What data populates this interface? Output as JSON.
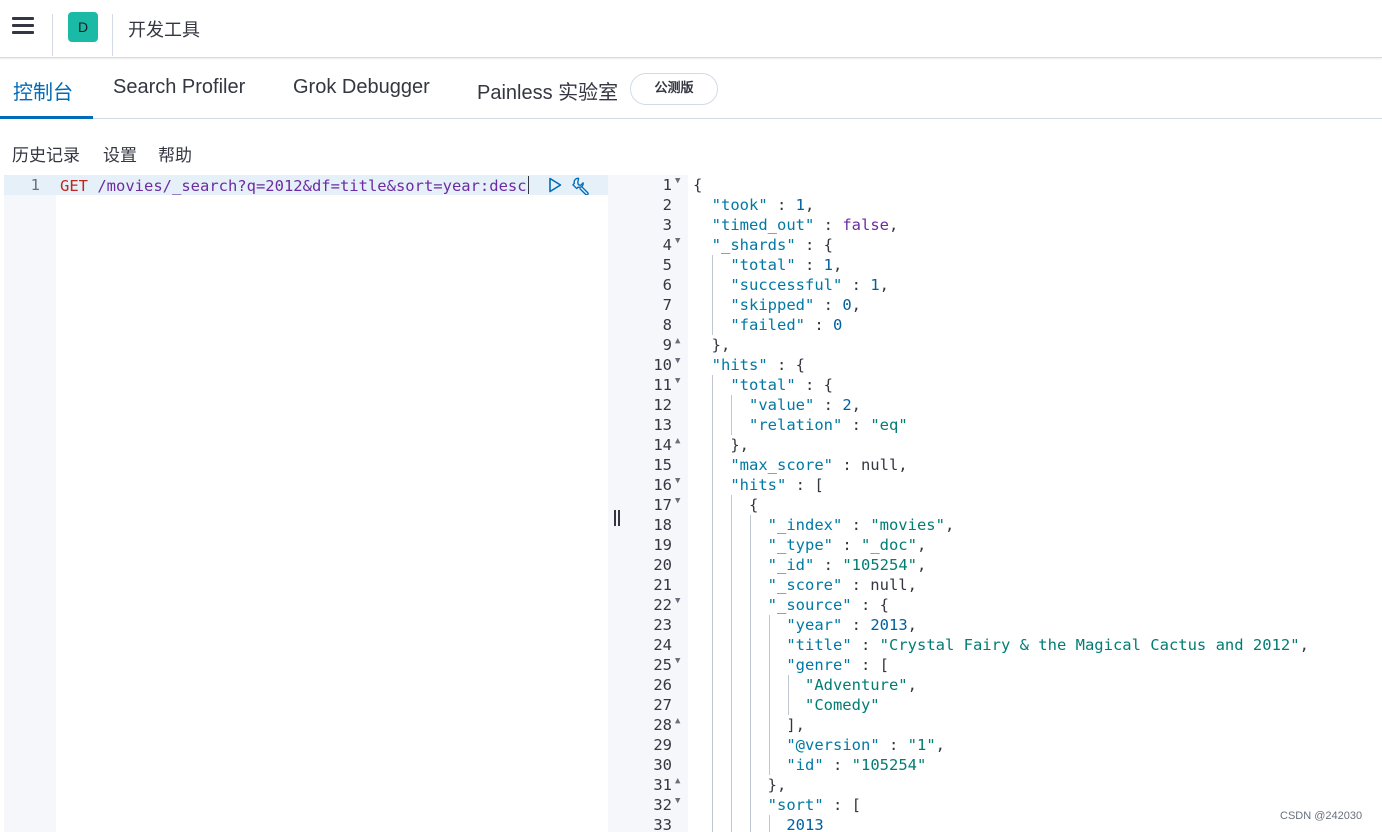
{
  "header": {
    "menu_icon": "hamburger-menu-icon",
    "space_initial": "D",
    "space_color": "#1bbaa6",
    "app_title": "开发工具"
  },
  "tabs": [
    {
      "label": "控制台",
      "active": true
    },
    {
      "label": "Search Profiler",
      "active": false
    },
    {
      "label": "Grok Debugger",
      "active": false
    },
    {
      "label": "Painless 实验室",
      "active": false
    }
  ],
  "beta_badge": "公测版",
  "submenu": [
    "历史记录",
    "设置",
    "帮助"
  ],
  "request": {
    "line_number": "1",
    "method": "GET",
    "url": " /movies/_search?q=2012&df=title&sort=year:desc",
    "run_icon": "play-icon",
    "settings_icon": "wrench-icon"
  },
  "response_lines": [
    {
      "n": "1",
      "fold": "open",
      "code": "{"
    },
    {
      "n": "2",
      "code": "  \"took\" : 1,"
    },
    {
      "n": "3",
      "code": "  \"timed_out\" : false,"
    },
    {
      "n": "4",
      "fold": "open",
      "code": "  \"_shards\" : {"
    },
    {
      "n": "5",
      "code": "    \"total\" : 1,"
    },
    {
      "n": "6",
      "code": "    \"successful\" : 1,"
    },
    {
      "n": "7",
      "code": "    \"skipped\" : 0,"
    },
    {
      "n": "8",
      "code": "    \"failed\" : 0"
    },
    {
      "n": "9",
      "fold": "close",
      "code": "  },"
    },
    {
      "n": "10",
      "fold": "open",
      "code": "  \"hits\" : {"
    },
    {
      "n": "11",
      "fold": "open",
      "code": "    \"total\" : {"
    },
    {
      "n": "12",
      "code": "      \"value\" : 2,"
    },
    {
      "n": "13",
      "code": "      \"relation\" : \"eq\""
    },
    {
      "n": "14",
      "fold": "close",
      "code": "    },"
    },
    {
      "n": "15",
      "code": "    \"max_score\" : null,"
    },
    {
      "n": "16",
      "fold": "open",
      "code": "    \"hits\" : ["
    },
    {
      "n": "17",
      "fold": "open",
      "code": "      {"
    },
    {
      "n": "18",
      "code": "        \"_index\" : \"movies\","
    },
    {
      "n": "19",
      "code": "        \"_type\" : \"_doc\","
    },
    {
      "n": "20",
      "code": "        \"_id\" : \"105254\","
    },
    {
      "n": "21",
      "code": "        \"_score\" : null,"
    },
    {
      "n": "22",
      "fold": "open",
      "code": "        \"_source\" : {"
    },
    {
      "n": "23",
      "code": "          \"year\" : 2013,"
    },
    {
      "n": "24",
      "code": "          \"title\" : \"Crystal Fairy & the Magical Cactus and 2012\","
    },
    {
      "n": "25",
      "fold": "open",
      "code": "          \"genre\" : ["
    },
    {
      "n": "26",
      "code": "            \"Adventure\","
    },
    {
      "n": "27",
      "code": "            \"Comedy\""
    },
    {
      "n": "28",
      "fold": "close",
      "code": "          ],"
    },
    {
      "n": "29",
      "code": "          \"@version\" : \"1\","
    },
    {
      "n": "30",
      "code": "          \"id\" : \"105254\""
    },
    {
      "n": "31",
      "fold": "close",
      "code": "        },"
    },
    {
      "n": "32",
      "fold": "open",
      "code": "        \"sort\" : ["
    },
    {
      "n": "33",
      "code": "          2013"
    }
  ],
  "watermark": "CSDN @242030"
}
